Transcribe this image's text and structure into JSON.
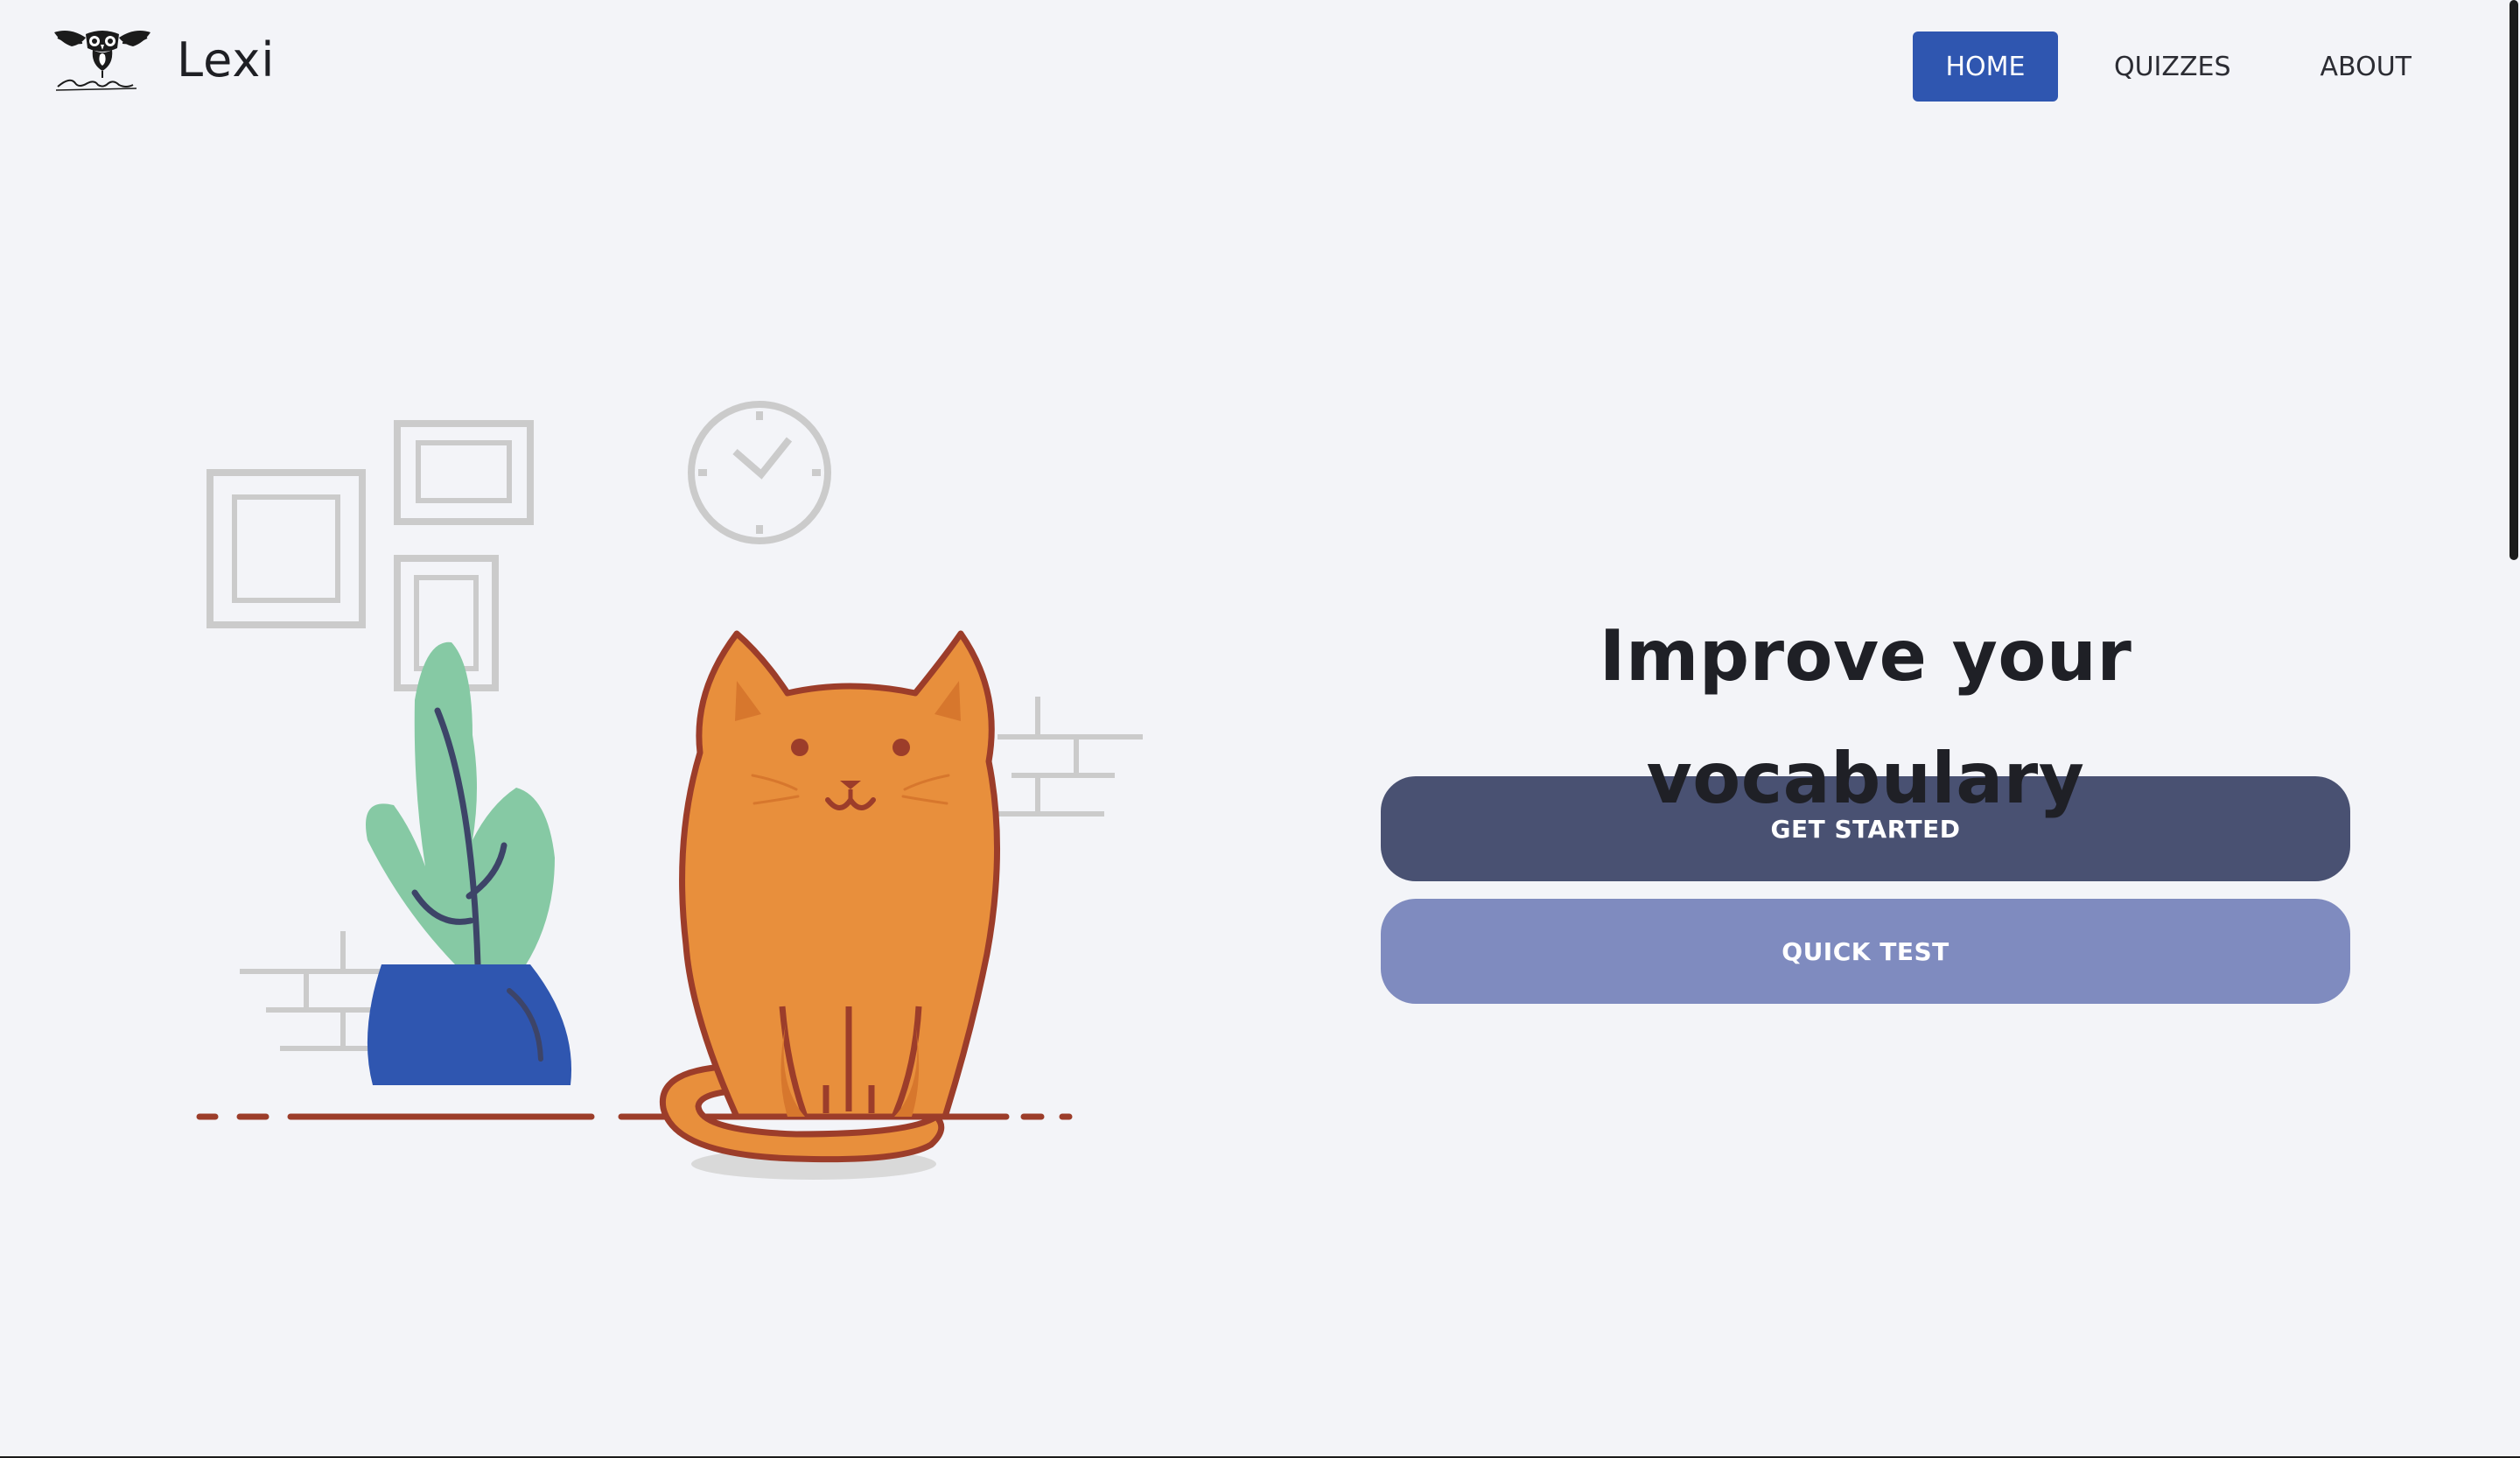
{
  "brand": {
    "name": "Lexi",
    "logo_icon": "owl-logo-icon"
  },
  "nav": {
    "items": [
      {
        "label": "HOME",
        "active": true
      },
      {
        "label": "QUIZZES",
        "active": false
      },
      {
        "label": "ABOUT",
        "active": false
      }
    ]
  },
  "hero": {
    "title": "Improve your vocabulary",
    "primary_button": "GET STARTED",
    "secondary_button": "QUICK TEST"
  },
  "colors": {
    "background": "#f3f4f8",
    "nav_active": "#2f56b0",
    "button_primary": "#495172",
    "button_secondary": "#7f8bbf",
    "cat_body": "#e88f3c",
    "cat_outline": "#9c3d2a",
    "plant_leaf": "#86c9a4",
    "plant_pot": "#2f56b0"
  },
  "illustration": {
    "icon": "cat-and-plant-illustration"
  }
}
